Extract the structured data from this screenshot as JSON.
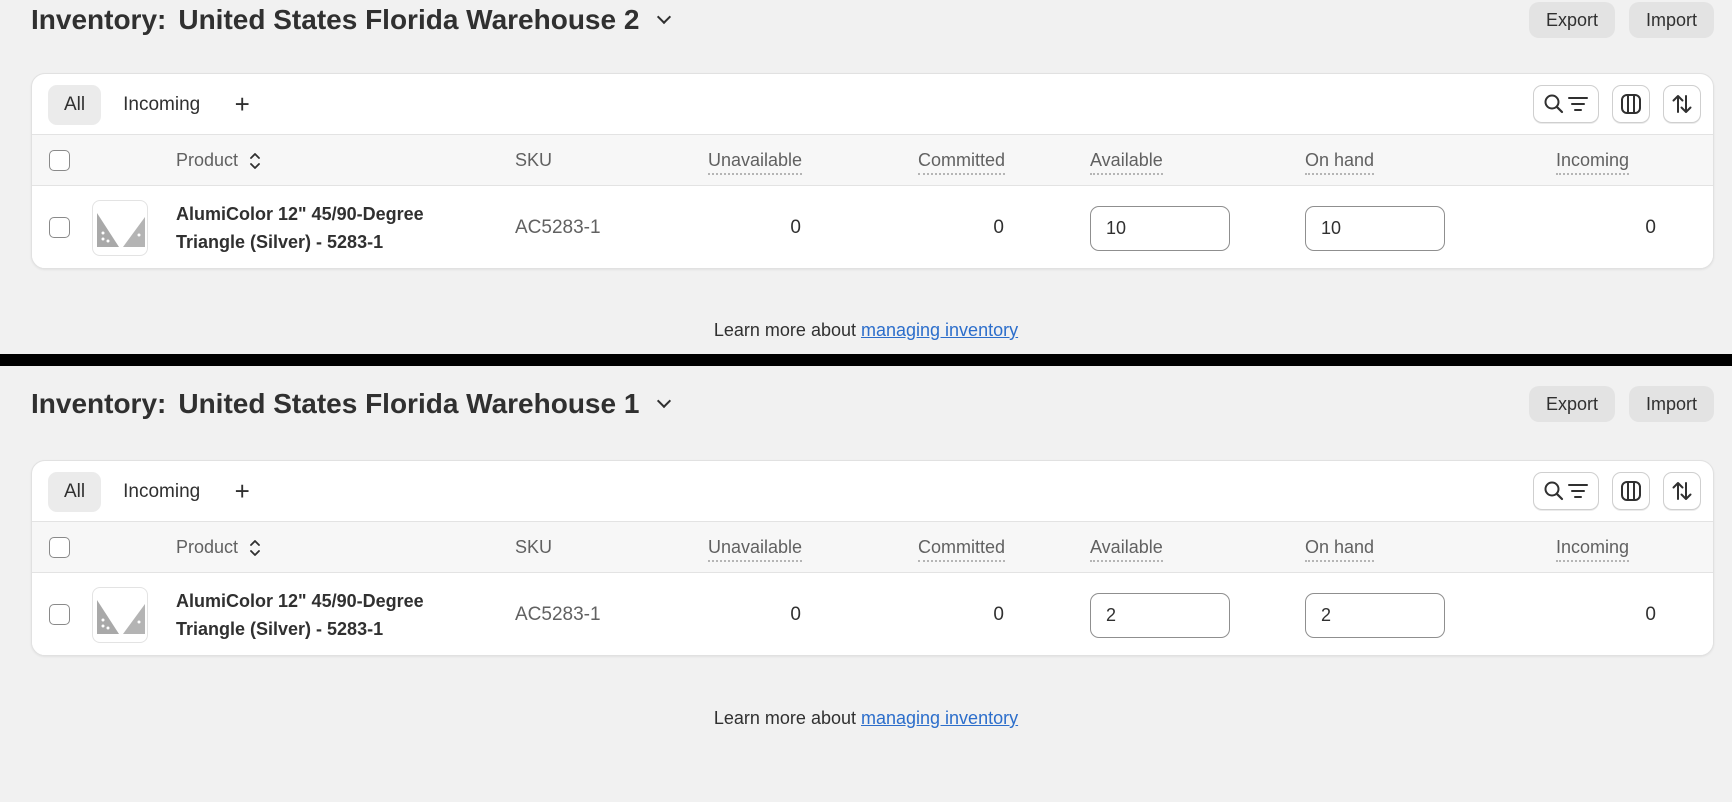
{
  "panels": [
    {
      "title_prefix": "Inventory:",
      "location": "United States Florida Warehouse 2",
      "export_label": "Export",
      "import_label": "Import",
      "tabs": [
        "All",
        "Incoming"
      ],
      "columns": [
        "Product",
        "SKU",
        "Unavailable",
        "Committed",
        "Available",
        "On hand",
        "Incoming"
      ],
      "row": {
        "product_line1": "AlumiColor 12\" 45/90-Degree",
        "product_line2": "Triangle (Silver) - 5283-1",
        "sku": "AC5283-1",
        "unavailable": "0",
        "committed": "0",
        "available": "10",
        "on_hand": "10",
        "incoming": "0"
      },
      "learn_text": "Learn more about ",
      "learn_link": "managing inventory"
    },
    {
      "title_prefix": "Inventory:",
      "location": "United States Florida Warehouse 1",
      "export_label": "Export",
      "import_label": "Import",
      "tabs": [
        "All",
        "Incoming"
      ],
      "columns": [
        "Product",
        "SKU",
        "Unavailable",
        "Committed",
        "Available",
        "On hand",
        "Incoming"
      ],
      "row": {
        "product_line1": "AlumiColor 12\" 45/90-Degree",
        "product_line2": "Triangle (Silver) - 5283-1",
        "sku": "AC5283-1",
        "unavailable": "0",
        "committed": "0",
        "available": "2",
        "on_hand": "2",
        "incoming": "0"
      },
      "learn_text": "Learn more about ",
      "learn_link": "managing inventory"
    }
  ],
  "icons": {
    "location_dropdown": "chevron-down-icon",
    "add_tab": "plus-icon",
    "search_filter": "search-filter-icon",
    "columns": "columns-icon",
    "sort": "sort-icon",
    "product_sort": "sort-arrows-icon",
    "thumbnail": "product-thumbnail"
  },
  "colors": {
    "page_bg": "#f1f1f1",
    "link": "#2c6ecb",
    "divider": "#000000"
  }
}
